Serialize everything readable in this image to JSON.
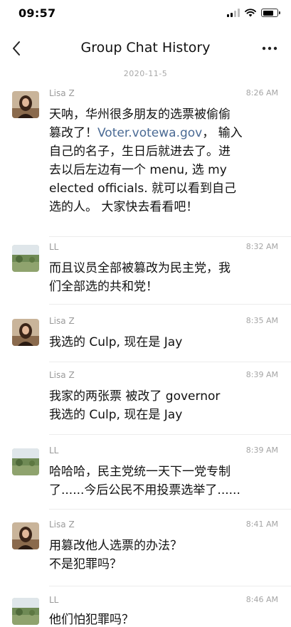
{
  "status": {
    "time": "09:57"
  },
  "nav": {
    "title": "Group Chat History"
  },
  "date_separator": "2020-11-5",
  "messages": [
    {
      "sender": "Lisa Z",
      "time": "8:26 AM",
      "avatar": "lisa",
      "lines": [
        "天呐，华州很多朋友的选票被偷偷",
        "篡改了！",
        "Voter.votewa.gov",
        "，  输入",
        "自己的名子，生日后就进去了。进",
        "去以后左边有一个 menu, 选 my",
        "elected officials. 就可以看到自己",
        "选的人。 大家快去看看吧！"
      ]
    },
    {
      "sender": "LL",
      "time": "8:32 AM",
      "avatar": "ll",
      "lines": [
        "而且议员全部被篡改为民主党，我",
        "们全部选的共和党！"
      ]
    },
    {
      "sender": "Lisa Z",
      "time": "8:35 AM",
      "avatar": "lisa",
      "lines": [
        "我选的 Culp, 现在是 Jay"
      ]
    },
    {
      "sender": "Lisa Z",
      "time": "8:39 AM",
      "avatar": "none",
      "lines": [
        "我家的两张票 被改了 governor",
        "我选的 Culp, 现在是 Jay"
      ]
    },
    {
      "sender": "LL",
      "time": "8:39 AM",
      "avatar": "ll",
      "lines": [
        "哈哈哈，民主党统一天下一党专制",
        "了......今后公民不用投票选举了......"
      ]
    },
    {
      "sender": "Lisa Z",
      "time": "8:41 AM",
      "avatar": "lisa",
      "lines": [
        "用篡改他人选票的办法？",
        "不是犯罪吗？"
      ]
    },
    {
      "sender": "LL",
      "time": "8:46 AM",
      "avatar": "ll",
      "lines": [
        "他们怕犯罪吗？"
      ]
    }
  ]
}
